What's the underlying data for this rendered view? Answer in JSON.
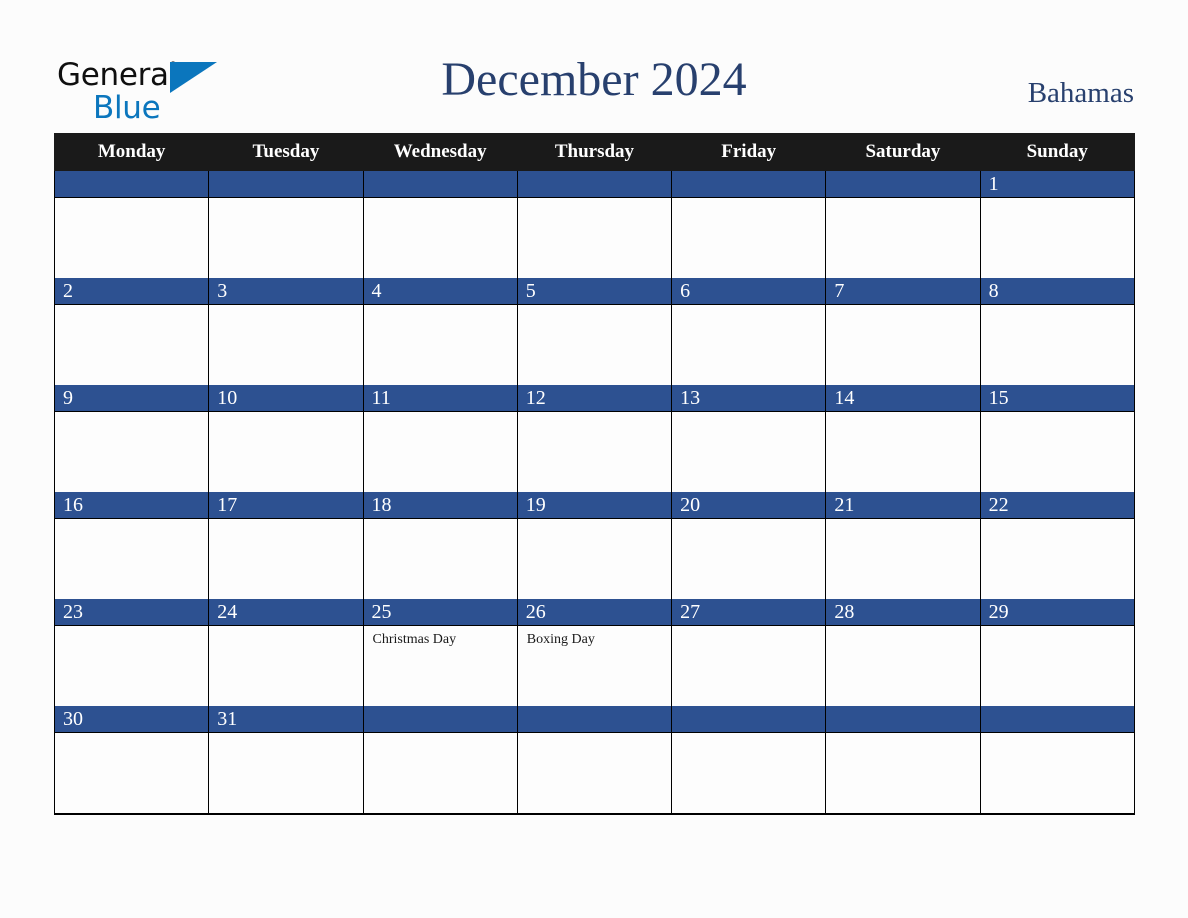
{
  "brand": {
    "name_part1": "General",
    "name_part2": "Blue",
    "triangle_color": "#0b76bd"
  },
  "header": {
    "title": "December 2024",
    "country": "Bahamas"
  },
  "theme": {
    "header_bg": "#1a1a1a",
    "date_band_blue": "#2d5191",
    "title_navy": "#28406e",
    "page_bg": "#fcfcfc",
    "grid_line": "#000000"
  },
  "weekdays": [
    "Monday",
    "Tuesday",
    "Wednesday",
    "Thursday",
    "Friday",
    "Saturday",
    "Sunday"
  ],
  "weeks": [
    [
      {
        "date": "",
        "events": []
      },
      {
        "date": "",
        "events": []
      },
      {
        "date": "",
        "events": []
      },
      {
        "date": "",
        "events": []
      },
      {
        "date": "",
        "events": []
      },
      {
        "date": "",
        "events": []
      },
      {
        "date": "1",
        "events": []
      }
    ],
    [
      {
        "date": "2",
        "events": []
      },
      {
        "date": "3",
        "events": []
      },
      {
        "date": "4",
        "events": []
      },
      {
        "date": "5",
        "events": []
      },
      {
        "date": "6",
        "events": []
      },
      {
        "date": "7",
        "events": []
      },
      {
        "date": "8",
        "events": []
      }
    ],
    [
      {
        "date": "9",
        "events": []
      },
      {
        "date": "10",
        "events": []
      },
      {
        "date": "11",
        "events": []
      },
      {
        "date": "12",
        "events": []
      },
      {
        "date": "13",
        "events": []
      },
      {
        "date": "14",
        "events": []
      },
      {
        "date": "15",
        "events": []
      }
    ],
    [
      {
        "date": "16",
        "events": []
      },
      {
        "date": "17",
        "events": []
      },
      {
        "date": "18",
        "events": []
      },
      {
        "date": "19",
        "events": []
      },
      {
        "date": "20",
        "events": []
      },
      {
        "date": "21",
        "events": []
      },
      {
        "date": "22",
        "events": []
      }
    ],
    [
      {
        "date": "23",
        "events": []
      },
      {
        "date": "24",
        "events": []
      },
      {
        "date": "25",
        "events": [
          "Christmas Day"
        ]
      },
      {
        "date": "26",
        "events": [
          "Boxing Day"
        ]
      },
      {
        "date": "27",
        "events": []
      },
      {
        "date": "28",
        "events": []
      },
      {
        "date": "29",
        "events": []
      }
    ],
    [
      {
        "date": "30",
        "events": []
      },
      {
        "date": "31",
        "events": []
      },
      {
        "date": "",
        "events": []
      },
      {
        "date": "",
        "events": []
      },
      {
        "date": "",
        "events": []
      },
      {
        "date": "",
        "events": []
      },
      {
        "date": "",
        "events": []
      }
    ]
  ]
}
